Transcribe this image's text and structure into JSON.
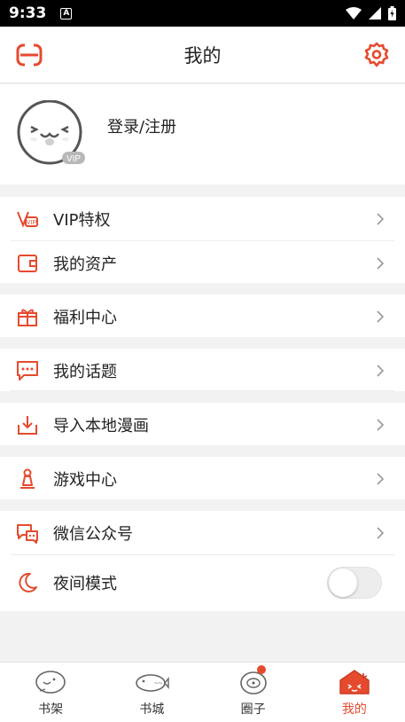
{
  "statusbar": {
    "time": "9:33",
    "app_icon_letter": "A"
  },
  "header": {
    "title": "我的"
  },
  "profile": {
    "login_label": "登录/注册",
    "vip_tag": "VIP"
  },
  "menu": {
    "vip": "VIP特权",
    "assets": "我的资产",
    "welfare": "福利中心",
    "topics": "我的话题",
    "import": "导入本地漫画",
    "games": "游戏中心",
    "wechat": "微信公众号",
    "night_mode": "夜间模式"
  },
  "night_mode_enabled": false,
  "tabs": [
    {
      "label": "书架",
      "active": false
    },
    {
      "label": "书城",
      "active": false
    },
    {
      "label": "圈子",
      "active": false,
      "badge": true
    },
    {
      "label": "我的",
      "active": true
    }
  ],
  "colors": {
    "accent": "#e64a2e",
    "background": "#f2f2f2",
    "text": "#222222"
  }
}
